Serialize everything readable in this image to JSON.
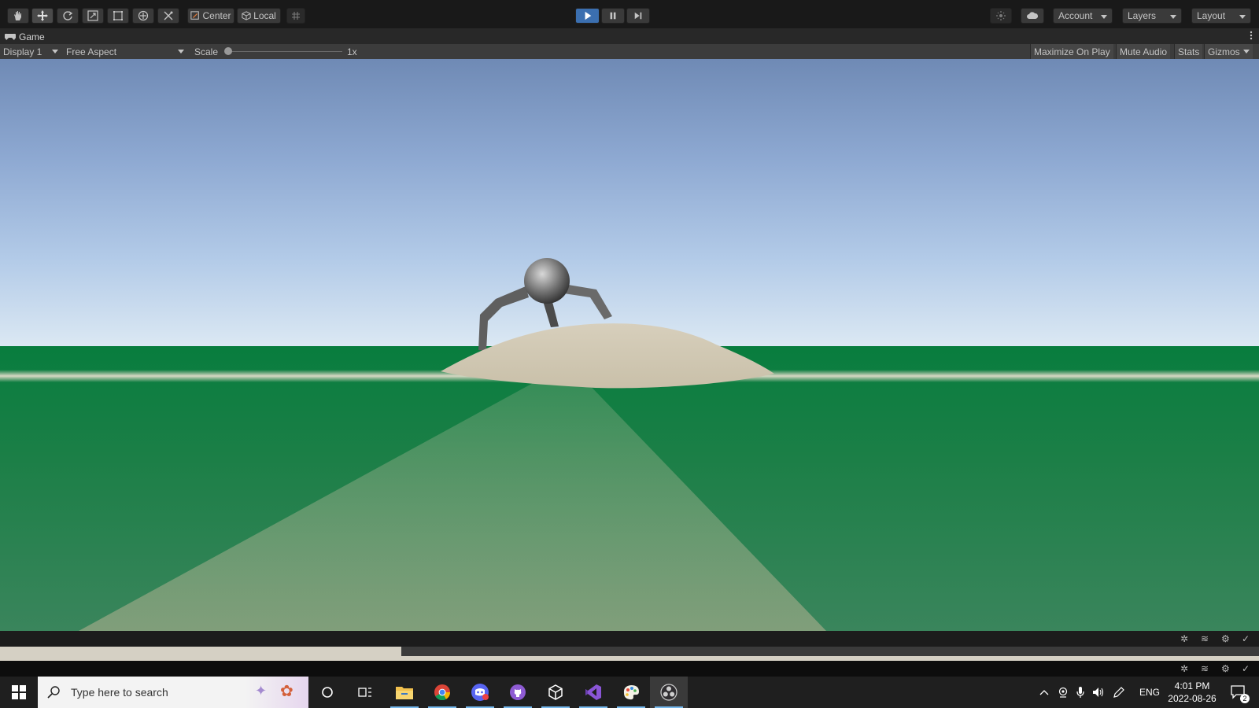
{
  "toolbar": {
    "tools": [
      "hand-icon",
      "move-icon",
      "rotate-icon",
      "scale-icon",
      "rect-icon",
      "transform-icon",
      "custom-tool-icon"
    ],
    "pivot_label": "Center",
    "space_label": "Local",
    "account_label": "Account",
    "layers_label": "Layers",
    "layout_label": "Layout"
  },
  "tab": {
    "title": "Game"
  },
  "gamebar": {
    "display": "Display 1",
    "aspect": "Free Aspect",
    "scale_label": "Scale",
    "scale_value": "1x",
    "scale_fraction": 0.0,
    "maximize": "Maximize On Play",
    "mute": "Mute Audio",
    "stats": "Stats",
    "gizmos": "Gizmos"
  },
  "colors": {
    "accent": "#3b6fb0",
    "ground": "#087d3e",
    "sky_top": "#6f8ab5",
    "mound": "#cfc6b0"
  },
  "taskbar": {
    "search_placeholder": "Type here to search",
    "apps": [
      "file-explorer-icon",
      "chrome-icon",
      "discord-icon",
      "github-icon",
      "unity-icon",
      "visual-studio-icon",
      "paint-icon",
      "obs-icon"
    ],
    "lang": "ENG",
    "time": "4:01 PM",
    "date": "2022-08-26",
    "notification_count": "2"
  }
}
